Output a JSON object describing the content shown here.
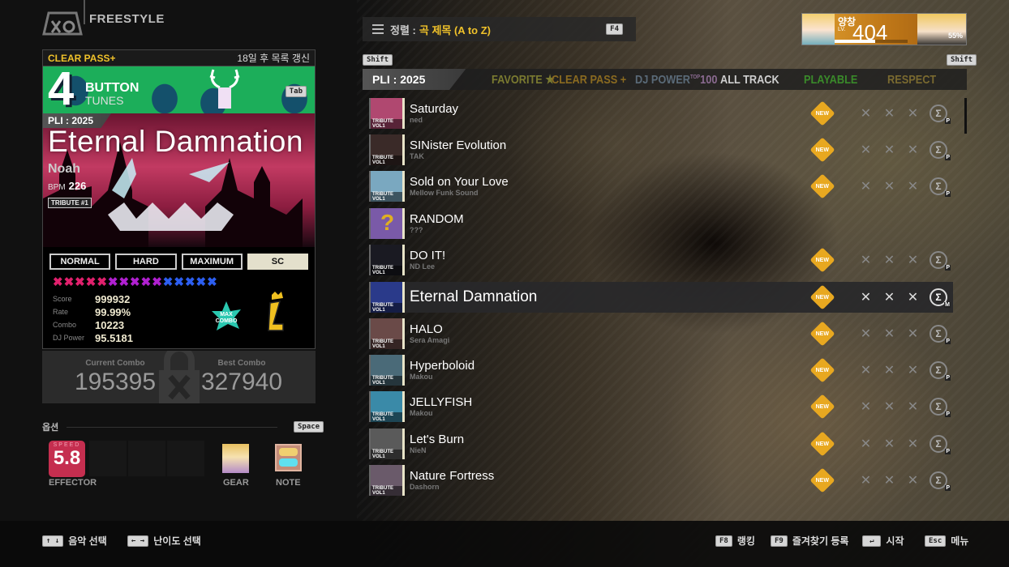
{
  "header": {
    "mode": "FREESTYLE"
  },
  "card": {
    "clear_pass_label": "CLEAR PASS+",
    "refresh_note": "18일 후 목록 갱신",
    "button_count": "4",
    "button_label": "BUTTON",
    "tunes_label": "TUNES",
    "tab_key": "Tab",
    "pli": "PLI : 2025",
    "title": "Eternal Damnation",
    "artist": "Noah",
    "bpm_label": "BPM",
    "bpm": "226",
    "tribute": "TRIBUTE #1",
    "difficulties": [
      {
        "label": "NORMAL",
        "active": false
      },
      {
        "label": "HARD",
        "active": false
      },
      {
        "label": "MAXIMUM",
        "active": false
      },
      {
        "label": "SC",
        "active": true
      }
    ],
    "stars": {
      "total": 15,
      "pink": 5,
      "purple": 5,
      "blue": 5,
      "colors": [
        "#e0206c",
        "#b020d0",
        "#2c5ef0"
      ]
    },
    "stats": [
      {
        "label": "Score",
        "value": "999932"
      },
      {
        "label": "Rate",
        "value": "99.99%"
      },
      {
        "label": "Combo",
        "value": "10223"
      },
      {
        "label": "DJ Power",
        "value": "95.5181"
      }
    ],
    "max_combo_badge": "MAX COMBO"
  },
  "combo": {
    "current_label": "Current Combo",
    "current": "195395",
    "best_label": "Best Combo",
    "best": "327940"
  },
  "options": {
    "heading": "옵션",
    "space_key": "Space",
    "speed_label": "SPEED",
    "speed": "5.8",
    "effector": "EFFECTOR",
    "gear": "GEAR",
    "note": "NOTE"
  },
  "sort": {
    "label": "정렬 :",
    "value": "곡 제목 (A to Z)",
    "key": "F4"
  },
  "player": {
    "name": "양창",
    "lv_label": "LV.",
    "level": "404",
    "exp_percent": 55,
    "exp_text": "55%"
  },
  "tabs": {
    "shift_left": "Shift",
    "shift_right": "Shift",
    "items": [
      {
        "label": "PLI : 2025",
        "color": "#ffffff"
      },
      {
        "label": "FAVORITE ★",
        "color": "#7a7a30"
      },
      {
        "label": "CLEAR PASS +",
        "color": "#8a6a20"
      },
      {
        "label": "DJ POWER",
        "sup": "TOP",
        "extra": "100",
        "color": "#5a6a78",
        "extra_color": "#8a6a90"
      },
      {
        "label": "ALL TRACK",
        "color": "#cfcfcf"
      },
      {
        "label": "PLAYABLE",
        "color": "#3a8a2a"
      },
      {
        "label": "RESPECT",
        "color": "#7a6a30"
      }
    ]
  },
  "tracks": [
    {
      "title": "Saturday",
      "artist": "ned",
      "new": true,
      "sig": "P",
      "jacket": "#b04870",
      "selected": false
    },
    {
      "title": "SINister Evolution",
      "artist": "TAK",
      "new": true,
      "sig": "P",
      "jacket": "#3a2a28",
      "selected": false
    },
    {
      "title": "Sold on Your Love",
      "artist": "Mellow Funk Sound",
      "new": true,
      "sig": "P",
      "jacket": "#7aa8c0",
      "selected": false
    },
    {
      "title": "RANDOM",
      "artist": "???",
      "new": false,
      "sig": "",
      "jacket": "#7a5aa8",
      "selected": false
    },
    {
      "title": "DO IT!",
      "artist": "ND Lee",
      "new": true,
      "sig": "P",
      "jacket": "#1a1a22",
      "selected": false
    },
    {
      "title": "Eternal Damnation",
      "artist": "",
      "new": true,
      "sig": "M",
      "jacket": "#2a3a8a",
      "selected": true
    },
    {
      "title": "HALO",
      "artist": "Sera Amagi",
      "new": true,
      "sig": "P",
      "jacket": "#6a4a48",
      "selected": false
    },
    {
      "title": "Hyperboloid",
      "artist": "Makou",
      "new": true,
      "sig": "P",
      "jacket": "#4a6a78",
      "selected": false
    },
    {
      "title": "JELLYFISH",
      "artist": "Makou",
      "new": true,
      "sig": "P",
      "jacket": "#3a8aa8",
      "selected": false
    },
    {
      "title": "Let's Burn",
      "artist": "NieN",
      "new": true,
      "sig": "P",
      "jacket": "#5a5a5a",
      "selected": false
    },
    {
      "title": "Nature Fortress",
      "artist": "Dashorn",
      "new": true,
      "sig": "P",
      "jacket": "#6a5a6a",
      "selected": false
    }
  ],
  "track_labels": {
    "new_badge": "NEW",
    "jacket_vol": "TRIBUTE VOL1",
    "random_glyph": "?"
  },
  "footer": {
    "left": [
      {
        "keys": "↑ ↓",
        "label": "음악 선택"
      },
      {
        "keys": "← →",
        "label": "난이도 선택"
      }
    ],
    "right": [
      {
        "keys": "F8",
        "label": "랭킹"
      },
      {
        "keys": "F9",
        "label": "즐겨찾기 등록"
      },
      {
        "keys": "↵",
        "label": "시작"
      },
      {
        "keys": "Esc",
        "label": "메뉴"
      }
    ]
  }
}
